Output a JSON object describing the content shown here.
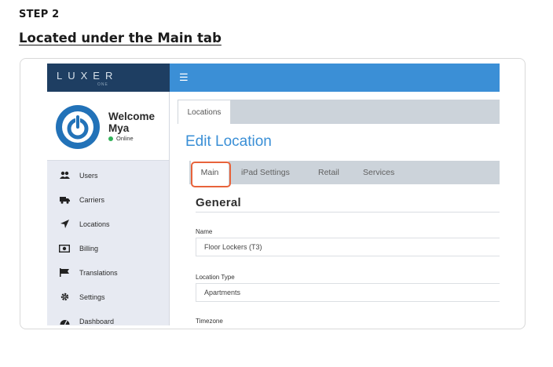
{
  "step": {
    "label": "STEP 2",
    "title": "Located under the Main tab"
  },
  "app": {
    "brand": {
      "logo": "LUXER",
      "logo_sub": "ONE"
    },
    "topbar": {
      "menu_icon": "hamburger-icon"
    },
    "profile": {
      "welcome": "Welcome",
      "name": "Mya",
      "status": "Online",
      "status_color": "#33b35a"
    },
    "sidebar": {
      "items": [
        {
          "label": "Users",
          "icon": "users-icon"
        },
        {
          "label": "Carriers",
          "icon": "truck-icon"
        },
        {
          "label": "Locations",
          "icon": "location-arrow-icon"
        },
        {
          "label": "Billing",
          "icon": "money-icon"
        },
        {
          "label": "Translations",
          "icon": "flag-icon"
        },
        {
          "label": "Settings",
          "icon": "gear-icon"
        },
        {
          "label": "Dashboard",
          "icon": "dashboard-icon"
        }
      ]
    },
    "main": {
      "top_tab": "Locations",
      "page_title": "Edit Location",
      "tabs": [
        {
          "label": "Main",
          "active": true
        },
        {
          "label": "iPad Settings",
          "active": false
        },
        {
          "label": "Retail",
          "active": false
        },
        {
          "label": "Services",
          "active": false
        }
      ],
      "section_title": "General",
      "fields": {
        "name_label": "Name",
        "name_value": "Floor Lockers (T3)",
        "type_label": "Location Type",
        "type_value": "Apartments",
        "timezone_label": "Timezone"
      }
    },
    "colors": {
      "accent": "#3b8fd6",
      "brand_bg": "#1e3e62",
      "highlight": "#e8633b"
    }
  }
}
